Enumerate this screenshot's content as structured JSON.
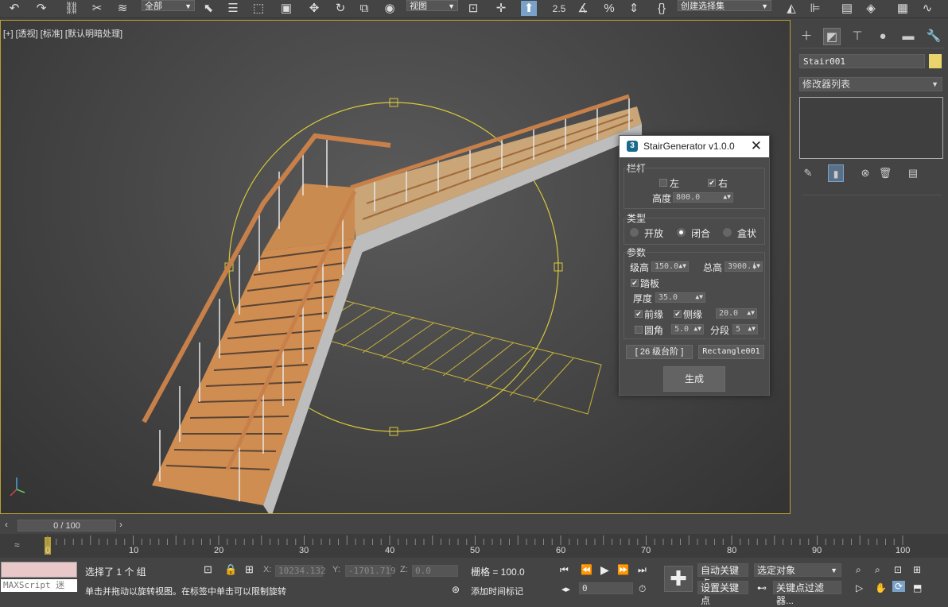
{
  "toolbar": {
    "selection_filter": "全部",
    "coord_system": "视图",
    "named_selection": "创建选择集",
    "snap_label": "2.5",
    "percent_label": "%"
  },
  "viewport": {
    "label": "[+] [透视] [标准] [默认明暗处理]"
  },
  "command_panel": {
    "object_name": "Stair001",
    "object_color": "#e9d56b",
    "modifier_list": "修改器列表"
  },
  "dialog": {
    "title": "StairGenerator v1.0.0",
    "logo": "3",
    "railing": {
      "group_label": "栏杆",
      "left_label": "左",
      "left_checked": false,
      "right_label": "右",
      "right_checked": true,
      "height_label": "高度",
      "height_value": "800.0"
    },
    "type": {
      "group_label": "类型",
      "options": [
        "开放",
        "闭合",
        "盒状"
      ],
      "selected": "闭合"
    },
    "params": {
      "group_label": "参数",
      "step_height_label": "级高",
      "step_height_value": "150.0",
      "total_height_label": "总高",
      "total_height_value": "3900.(",
      "tread_label": "踏板",
      "thickness_label": "厚度",
      "thickness_value": "35.0",
      "nosing_label": "前缘",
      "side_label": "侧缘",
      "side_value": "20.0",
      "fillet_label": "圆角",
      "fillet_value": "5.0",
      "segments_label": "分段",
      "segments_value": "5"
    },
    "steps_button": "[ 26 级台阶 ]",
    "path_button": "Rectangle001",
    "generate_button": "生成"
  },
  "timeline": {
    "frame_display": "0 / 100",
    "ticks": [
      "0",
      "10",
      "20",
      "30",
      "40",
      "50",
      "60",
      "70",
      "80",
      "90",
      "100"
    ]
  },
  "status": {
    "maxscript": "MAXScript 迷",
    "selected": "选择了 1 个 组",
    "hint": "单击并拖动以旋转视图。在标签中单击可以限制旋转",
    "x_label": "X:",
    "x_value": "10234.132",
    "y_label": "Y:",
    "y_value": "-1701.719",
    "z_label": "Z:",
    "z_value": "0.0",
    "grid": "栅格 = 100.0",
    "add_time_tag": "添加时间标记",
    "auto_key": "自动关键点",
    "set_key": "设置关键点",
    "selected_object": "选定对象",
    "key_filter": "关键点过滤器...",
    "frame_value": "0"
  }
}
